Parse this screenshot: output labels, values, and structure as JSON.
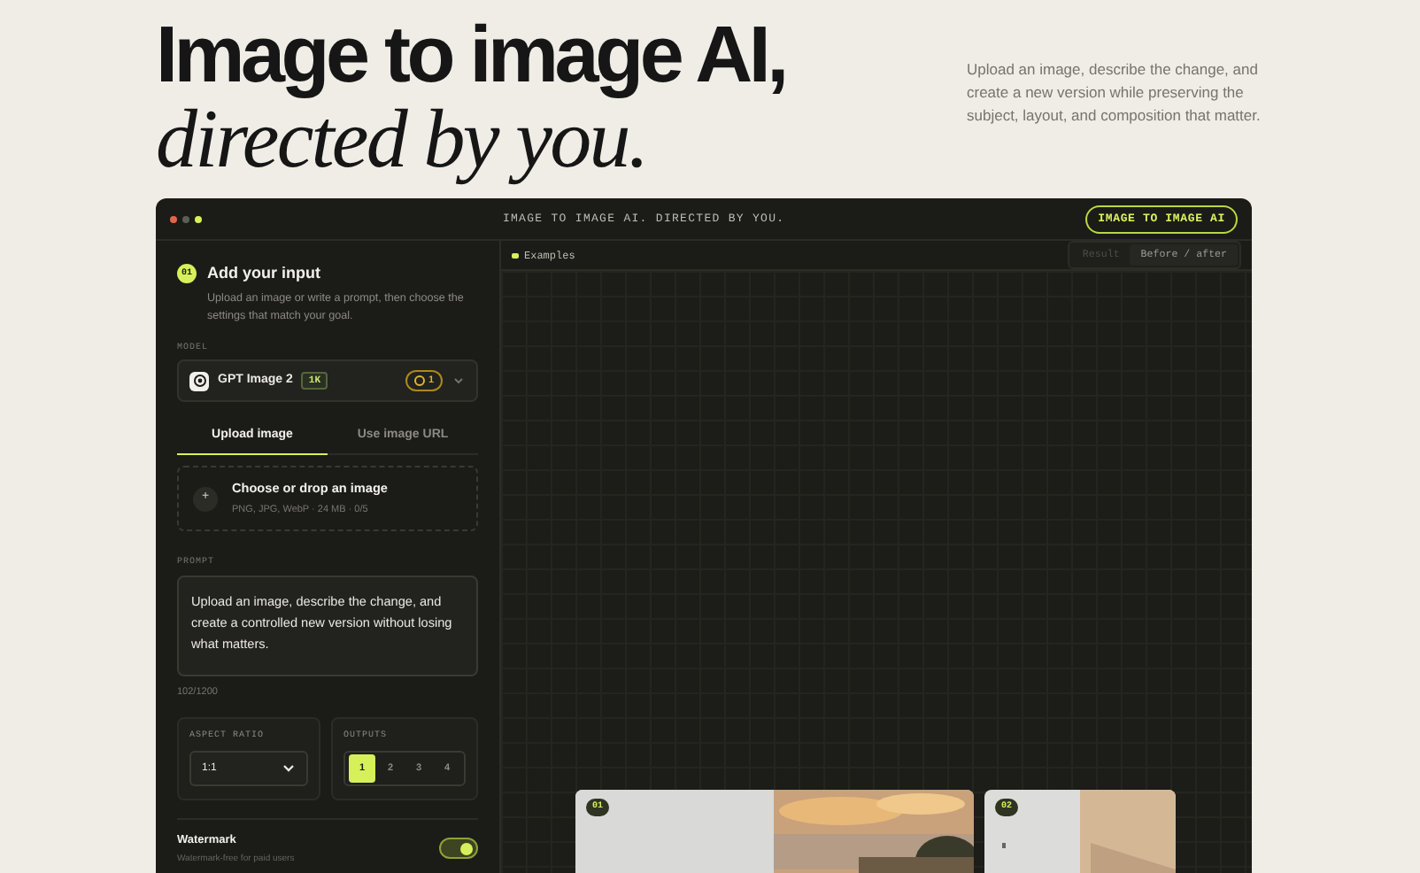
{
  "hero": {
    "title": "Image to image AI,",
    "title_italic": "directed by you.",
    "description": "Upload an image, describe the change, and create a new version while preserving the subject, layout, and composition that matter."
  },
  "window": {
    "title": "IMAGE TO IMAGE AI. DIRECTED BY YOU.",
    "badge": "IMAGE TO IMAGE AI"
  },
  "input_panel": {
    "step": "01",
    "title": "Add your input",
    "description": "Upload an image or write a prompt, then choose the settings that match your goal.",
    "model_label": "MODEL",
    "model": {
      "name": "GPT Image 2",
      "tag": "1K",
      "credits": "1"
    },
    "tabs": [
      {
        "label": "Upload image",
        "selected": true
      },
      {
        "label": "Use image URL",
        "selected": false
      }
    ],
    "upload": {
      "button": "+",
      "title": "Choose or drop an image",
      "hint": "PNG, JPG, WebP · 24 MB · 0/5"
    },
    "prompt_label": "PROMPT",
    "prompt": "Upload an image, describe the change, and create a controlled new version without losing what matters.",
    "prompt_count": "102/1200",
    "aspect_ratio": {
      "label": "ASPECT RATIO",
      "value": "1:1"
    },
    "outputs": {
      "label": "OUTPUTS",
      "options": [
        {
          "label": "1",
          "selected": true
        },
        {
          "label": "2",
          "selected": false
        },
        {
          "label": "3",
          "selected": false
        },
        {
          "label": "4",
          "selected": false
        }
      ]
    },
    "watermark": {
      "title": "Watermark",
      "description": "Watermark-free for paid users",
      "on": true
    }
  },
  "preview": {
    "examples_label": "Examples",
    "view_modes": [
      {
        "label": "Result",
        "selected": false
      },
      {
        "label": "Before / after",
        "selected": true
      }
    ],
    "examples": [
      {
        "badge": "01",
        "kind": "picture"
      },
      {
        "badge": "02",
        "kind": "picture"
      }
    ]
  }
}
